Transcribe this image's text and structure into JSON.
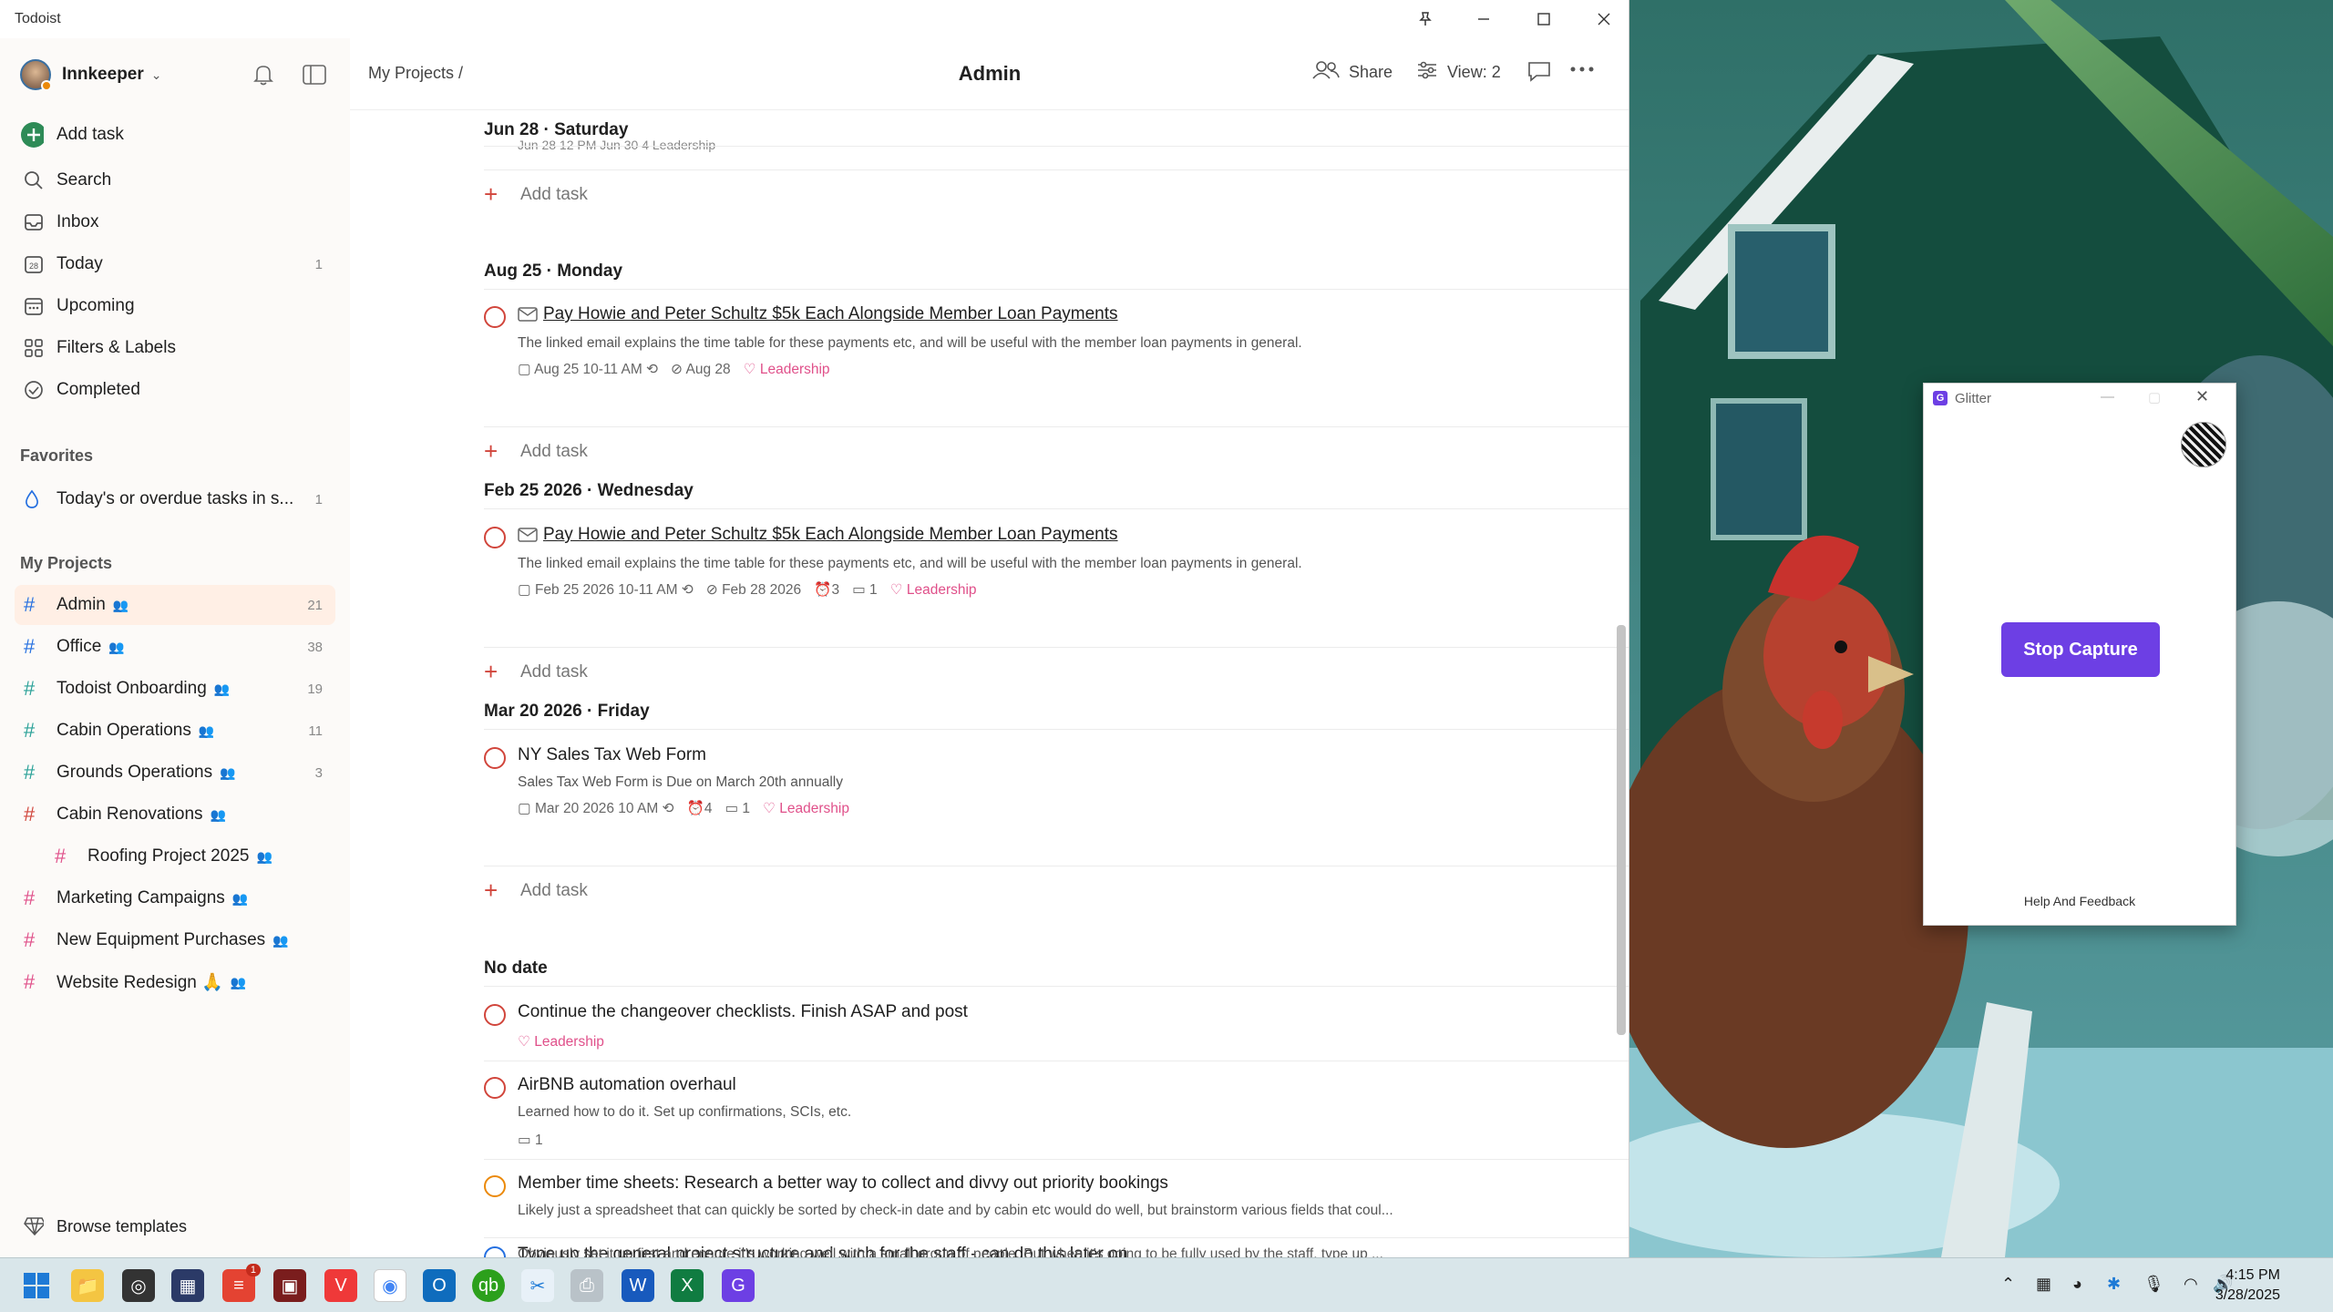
{
  "window": {
    "app_title": "Todoist"
  },
  "sidebar": {
    "user": "Innkeeper",
    "add_task": "Add task",
    "nav": [
      {
        "label": "Search",
        "count": ""
      },
      {
        "label": "Inbox",
        "count": ""
      },
      {
        "label": "Today",
        "count": "1"
      },
      {
        "label": "Upcoming",
        "count": ""
      },
      {
        "label": "Filters & Labels",
        "count": ""
      },
      {
        "label": "Completed",
        "count": ""
      }
    ],
    "favorites_heading": "Favorites",
    "favorites": [
      {
        "label": "Today's or overdue tasks in s...",
        "count": "1"
      }
    ],
    "projects_heading": "My Projects",
    "projects": [
      {
        "label": "Admin",
        "count": "21"
      },
      {
        "label": "Office",
        "count": "38"
      },
      {
        "label": "Todoist Onboarding",
        "count": "19"
      },
      {
        "label": "Cabin Operations",
        "count": "11"
      },
      {
        "label": "Grounds Operations",
        "count": "3"
      },
      {
        "label": "Cabin Renovations",
        "count": ""
      },
      {
        "label": "Roofing Project 2025",
        "count": ""
      },
      {
        "label": "Marketing Campaigns",
        "count": ""
      },
      {
        "label": "New Equipment Purchases",
        "count": ""
      },
      {
        "label": "Website Redesign 🙏",
        "count": ""
      }
    ],
    "browse_templates": "Browse templates"
  },
  "header": {
    "breadcrumb": "My Projects /",
    "title": "Admin",
    "share": "Share",
    "view": "View: 2"
  },
  "sections": [
    {
      "heading": "Jun 28 · Saturday",
      "partial_meta": "Jun 28 12 PM   Jun 30   4   Leadership",
      "add_task": "Add task"
    },
    {
      "heading": "Aug 25 · Monday",
      "task": {
        "title": "Pay Howie and Peter Schultz $5k Each Alongside Member Loan Payments",
        "desc": "The linked email explains the time table for these payments etc, and will be useful with the member loan payments in general.",
        "date": "Aug 25 10-11 AM",
        "deadline": "Aug 28",
        "label": "Leadership"
      },
      "add_task": "Add task"
    },
    {
      "heading": "Feb 25 2026 · Wednesday",
      "task": {
        "title": "Pay Howie and Peter Schultz $5k Each Alongside Member Loan Payments",
        "desc": "The linked email explains the time table for these payments etc, and will be useful with the member loan payments in general.",
        "date": "Feb 25 2026 10-11 AM",
        "deadline": "Feb 28 2026",
        "reminders": "3",
        "comments": "1",
        "label": "Leadership"
      },
      "add_task": "Add task"
    },
    {
      "heading": "Mar 20 2026 · Friday",
      "task": {
        "title": "NY Sales Tax Web Form",
        "desc": "Sales Tax Web Form is Due on March 20th annually",
        "date": "Mar 20 2026 10 AM",
        "reminders": "4",
        "comments": "1",
        "label": "Leadership"
      },
      "add_task": "Add task"
    },
    {
      "heading": "No date",
      "tasks": [
        {
          "title": "Continue the changeover checklists. Finish ASAP and post",
          "label": "Leadership"
        },
        {
          "title": "AirBNB automation overhaul",
          "desc": "Learned how to do it. Set up confirmations, SCIs, etc.",
          "comments": "1"
        },
        {
          "title": "Member time sheets: Research a better way to collect and divvy out priority bookings",
          "desc": "Likely just a spreadsheet that can quickly be sorted by check-in date and by cabin etc would do well, but brainstorm various fields that coul..."
        },
        {
          "title": "Type up the general project structure and such for the staff - can do this later on",
          "desc": "Obviously set it up first and ensure it's working well with a small group of people. But when it's going to be fully used by the staff, type up ..."
        }
      ]
    }
  ],
  "glitter": {
    "title": "Glitter",
    "button": "Stop Capture",
    "footer": "Help And Feedback"
  },
  "taskbar": {
    "time": "4:15 PM",
    "date": "3/28/2025",
    "todoist_badge": "1"
  },
  "colors": {
    "priority1": "#d1453b",
    "priority3": "#246fe0",
    "priority2": "#eb8909",
    "label_pink": "#e0508a",
    "glitter_purple": "#6d3fe4"
  }
}
